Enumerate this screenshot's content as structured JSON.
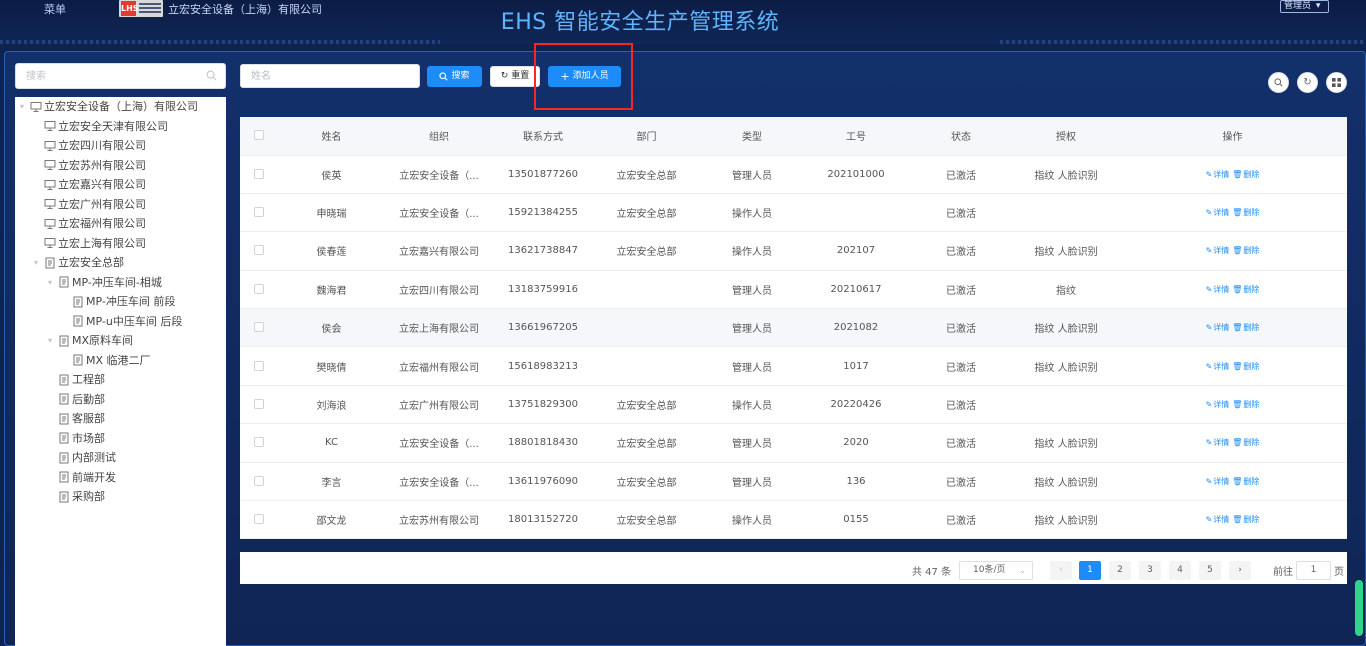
{
  "header": {
    "menu_label": "菜单",
    "logo_mark": "LHS",
    "company": "立宏安全设备（上海）有限公司",
    "title": "EHS 智能安全生产管理系统",
    "user_role": "管理员"
  },
  "tree": {
    "search_placeholder": "搜索",
    "nodes": [
      {
        "label": "立宏安全设备（上海）有限公司",
        "type": "org",
        "expanded": true
      },
      {
        "label": "立宏安全天津有限公司",
        "type": "org"
      },
      {
        "label": "立宏四川有限公司",
        "type": "org"
      },
      {
        "label": "立宏苏州有限公司",
        "type": "org"
      },
      {
        "label": "立宏嘉兴有限公司",
        "type": "org"
      },
      {
        "label": "立宏广州有限公司",
        "type": "org"
      },
      {
        "label": "立宏福州有限公司",
        "type": "org"
      },
      {
        "label": "立宏上海有限公司",
        "type": "org"
      },
      {
        "label": "立宏安全总部",
        "type": "dept",
        "expanded": true
      },
      {
        "label": "MP-冲压车间-相城",
        "type": "dept",
        "expanded": true
      },
      {
        "label": "MP-冲压车间 前段",
        "type": "dept"
      },
      {
        "label": "MP-u中压车间 后段",
        "type": "dept"
      },
      {
        "label": "MX原料车间",
        "type": "dept",
        "expanded": true
      },
      {
        "label": "MX 临港二厂",
        "type": "dept"
      },
      {
        "label": "工程部",
        "type": "dept"
      },
      {
        "label": "后勤部",
        "type": "dept"
      },
      {
        "label": "客服部",
        "type": "dept"
      },
      {
        "label": "市场部",
        "type": "dept"
      },
      {
        "label": "内部测试",
        "type": "dept"
      },
      {
        "label": "前端开发",
        "type": "dept"
      },
      {
        "label": "采购部",
        "type": "dept"
      }
    ]
  },
  "toolbar": {
    "name_placeholder": "姓名",
    "search_label": "搜索",
    "reset_label": "重置",
    "add_label": "添加人员",
    "right_icons": [
      "search-circle-icon",
      "refresh-circle-icon",
      "grid-circle-icon"
    ]
  },
  "table": {
    "columns": [
      "姓名",
      "组织",
      "联系方式",
      "部门",
      "类型",
      "工号",
      "状态",
      "授权",
      "操作"
    ],
    "detail_label": "详情",
    "delete_label": "删除",
    "rows": [
      {
        "name": "侯英",
        "org": "立宏安全设备（...",
        "phone": "13501877260",
        "dept": "立宏安全总部",
        "type": "管理人员",
        "no": "202101000",
        "status": "已激活",
        "auth": "指纹 人脸识别"
      },
      {
        "name": "申晓瑞",
        "org": "立宏安全设备（...",
        "phone": "15921384255",
        "dept": "立宏安全总部",
        "type": "操作人员",
        "no": "",
        "status": "已激活",
        "auth": ""
      },
      {
        "name": "侯春莲",
        "org": "立宏嘉兴有限公司",
        "phone": "13621738847",
        "dept": "立宏安全总部",
        "type": "操作人员",
        "no": "202107",
        "status": "已激活",
        "auth": "指纹 人脸识别"
      },
      {
        "name": "魏海君",
        "org": "立宏四川有限公司",
        "phone": "13183759916",
        "dept": "",
        "type": "管理人员",
        "no": "20210617",
        "status": "已激活",
        "auth": "指纹"
      },
      {
        "name": "侯会",
        "org": "立宏上海有限公司",
        "phone": "13661967205",
        "dept": "",
        "type": "管理人员",
        "no": "2021082",
        "status": "已激活",
        "auth": "指纹 人脸识别"
      },
      {
        "name": "樊晓倩",
        "org": "立宏福州有限公司",
        "phone": "15618983213",
        "dept": "",
        "type": "管理人员",
        "no": "1017",
        "status": "已激活",
        "auth": "指纹 人脸识别"
      },
      {
        "name": "刘海浪",
        "org": "立宏广州有限公司",
        "phone": "13751829300",
        "dept": "立宏安全总部",
        "type": "操作人员",
        "no": "20220426",
        "status": "已激活",
        "auth": ""
      },
      {
        "name": "KC",
        "org": "立宏安全设备（...",
        "phone": "18801818430",
        "dept": "立宏安全总部",
        "type": "管理人员",
        "no": "2020",
        "status": "已激活",
        "auth": "指纹 人脸识别"
      },
      {
        "name": "李言",
        "org": "立宏安全设备（...",
        "phone": "13611976090",
        "dept": "立宏安全总部",
        "type": "管理人员",
        "no": "136",
        "status": "已激活",
        "auth": "指纹 人脸识别"
      },
      {
        "name": "邵文龙",
        "org": "立宏苏州有限公司",
        "phone": "18013152720",
        "dept": "立宏安全总部",
        "type": "操作人员",
        "no": "0155",
        "status": "已激活",
        "auth": "指纹 人脸识别"
      }
    ]
  },
  "pagination": {
    "total_text": "共 47 条",
    "page_size": "10条/页",
    "pages": [
      "1",
      "2",
      "3",
      "4",
      "5"
    ],
    "current": "1",
    "goto_label": "前往",
    "goto_value": "1",
    "page_suffix": "页"
  },
  "colors": {
    "accent": "#1d8cf8",
    "background": "#0f2350",
    "highlight": "#ff2424",
    "title": "#5fb4ff"
  }
}
